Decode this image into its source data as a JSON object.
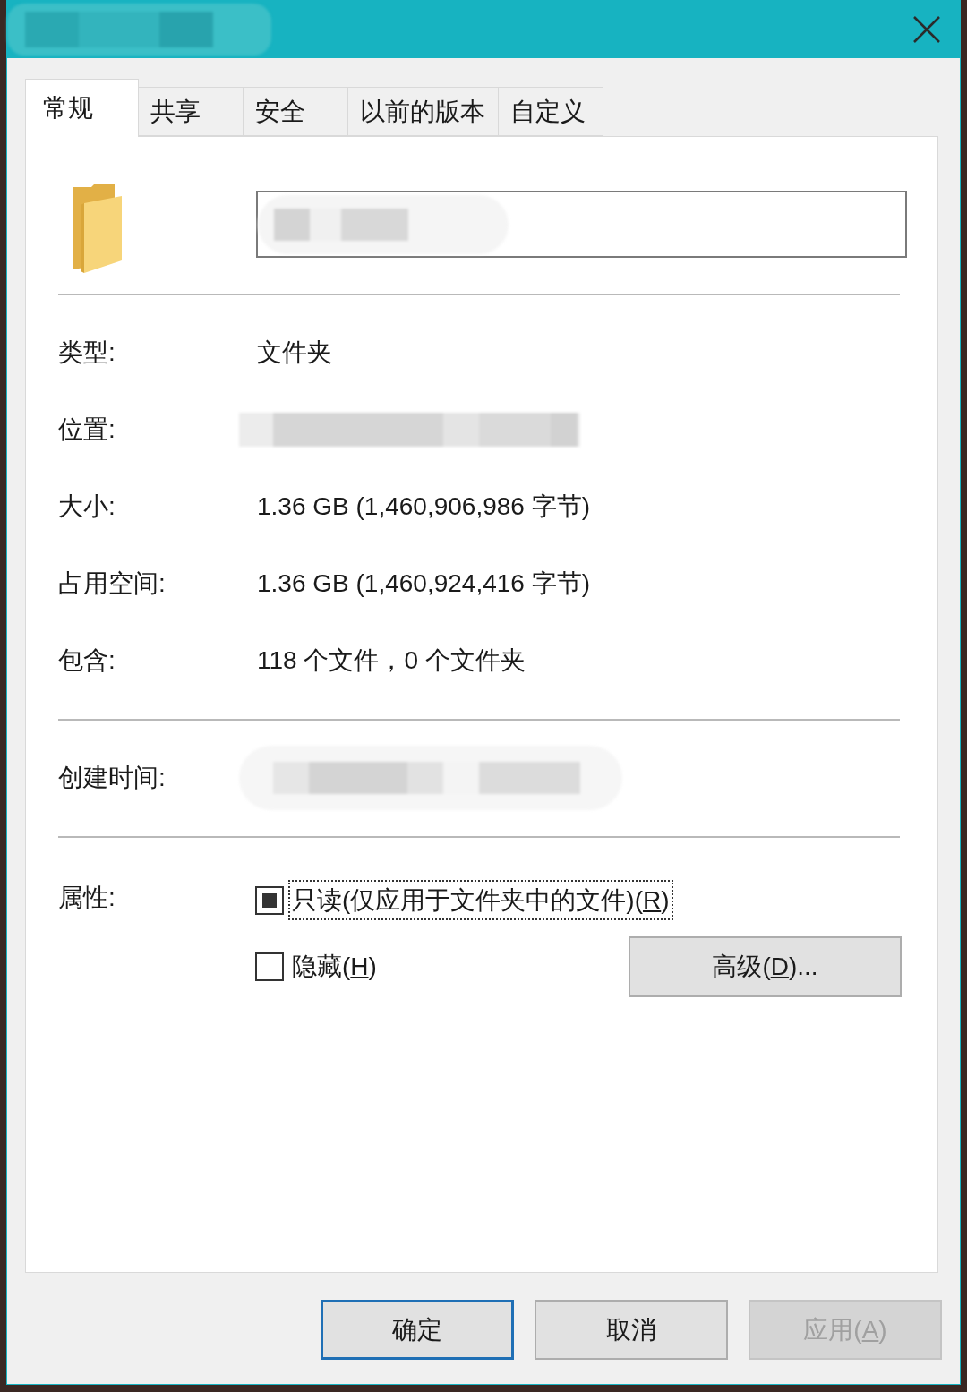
{
  "tabs": [
    {
      "label": "常规",
      "selected": true
    },
    {
      "label": "共享",
      "selected": false
    },
    {
      "label": "安全",
      "selected": false
    },
    {
      "label": "以前的版本",
      "selected": false
    },
    {
      "label": "自定义",
      "selected": false
    }
  ],
  "sections": [
    {
      "rows": [
        {
          "label": "类型:",
          "kind": "text",
          "value": "文件夹"
        },
        {
          "label": "位置:",
          "kind": "blurred"
        },
        {
          "label": "大小:",
          "kind": "text",
          "value": "1.36 GB (1,460,906,986 字节)"
        },
        {
          "label": "占用空间:",
          "kind": "text",
          "value": "1.36 GB (1,460,924,416 字节)"
        },
        {
          "label": "包含:",
          "kind": "text",
          "value": "118 个文件，0 个文件夹"
        }
      ]
    },
    {
      "rows": [
        {
          "label": "创建时间:",
          "kind": "blurred"
        }
      ]
    }
  ],
  "attributes": {
    "label": "属性:",
    "checkboxes": [
      {
        "text": "只读(仅应用于文件夹中的文件)(",
        "access_key": "R",
        "suffix": ")",
        "checked": false,
        "indeterminate": true,
        "focused": true
      },
      {
        "text": "隐藏(",
        "access_key": "H",
        "suffix": ")",
        "checked": false,
        "indeterminate": false,
        "focused": false
      }
    ],
    "advanced_button": {
      "text": "高级(",
      "access_key": "D",
      "suffix": ")..."
    }
  },
  "buttons": [
    {
      "text": "确定",
      "default": true,
      "disabled": false
    },
    {
      "text": "取消",
      "default": false,
      "disabled": false
    },
    {
      "text": "应用(",
      "access_key": "A",
      "suffix": ")",
      "default": false,
      "disabled": true
    }
  ]
}
